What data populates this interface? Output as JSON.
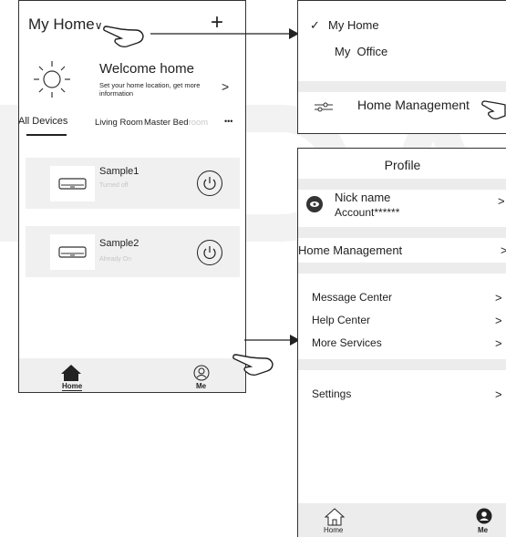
{
  "watermark": "MIDEA",
  "home_screen": {
    "home_selector": "My Home",
    "add_symbol": "+",
    "welcome_title": "Welcome home",
    "welcome_subtitle_line1": "Set your home location, get more",
    "welcome_subtitle_line2": "information",
    "welcome_arrow": ">",
    "tabs": [
      "All Devices",
      "Living Room",
      "Master Bed"
    ],
    "tabs_faded": "room",
    "tabs_more": "•••",
    "devices": [
      {
        "name": "Sample1",
        "status": "Turned off"
      },
      {
        "name": "Sample2",
        "status": "Already On"
      }
    ],
    "nav": {
      "home": "Home",
      "me": "Me"
    }
  },
  "home_dropdown": {
    "check_mark": "✓",
    "items": [
      "My Home",
      "My  Office"
    ],
    "management": "Home Management"
  },
  "profile_screen": {
    "title": "Profile",
    "nick_name": "Nick name",
    "account": "Account******",
    "chevron": ">",
    "home_management": "Home Management",
    "menu": [
      "Message Center",
      "Help Center",
      "More Services"
    ],
    "settings": "Settings",
    "nav": {
      "home": "Home",
      "me": "Me"
    }
  }
}
